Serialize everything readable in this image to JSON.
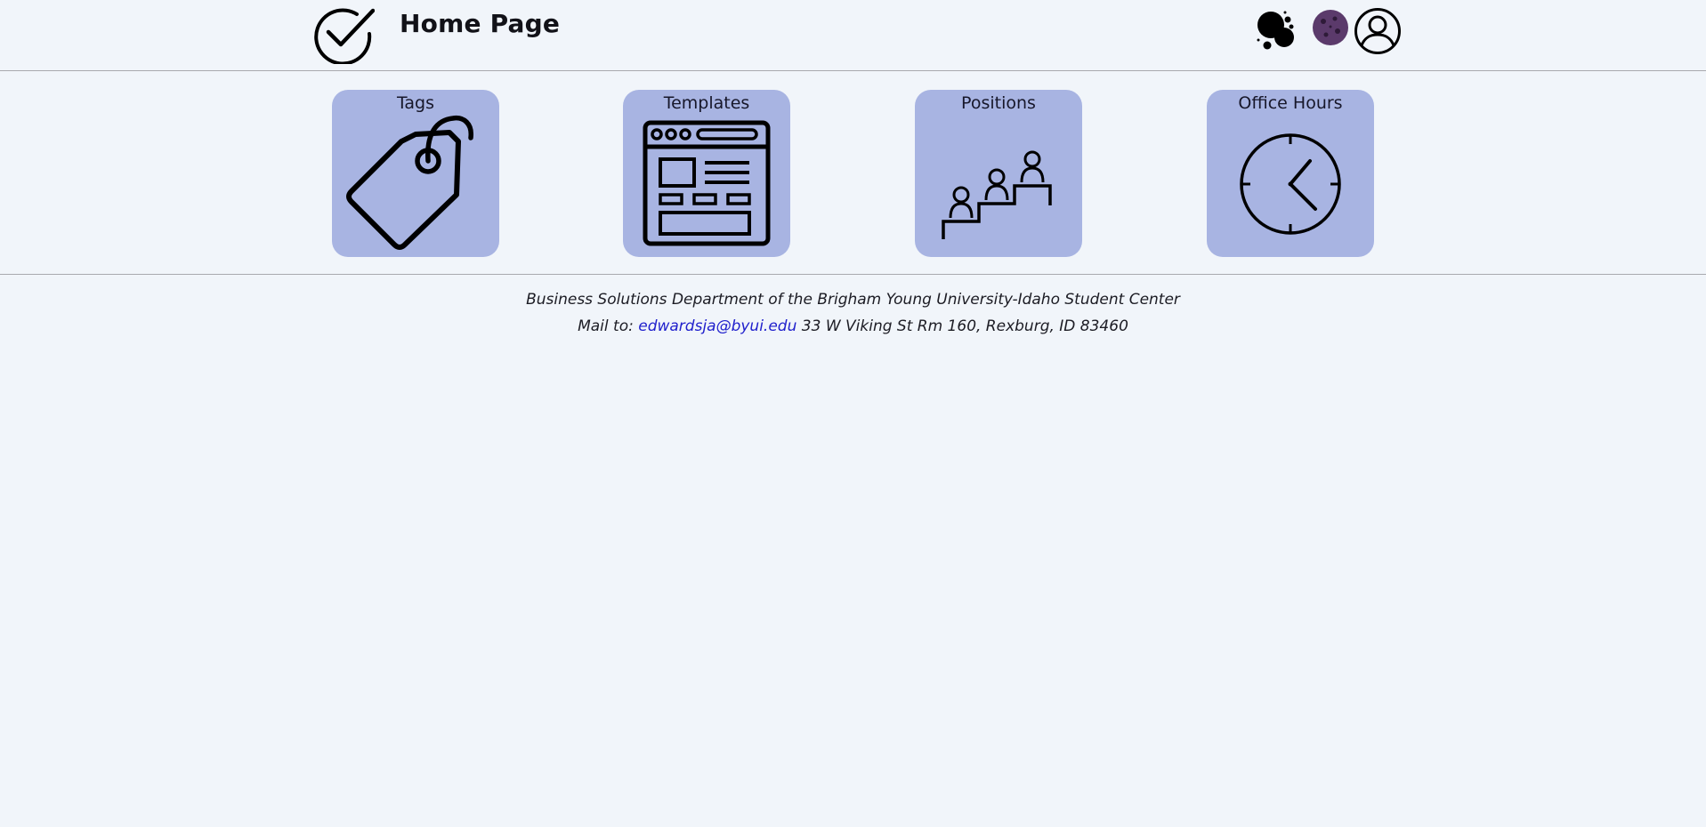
{
  "header": {
    "title": "Home Page",
    "logo_icon": "check-circle-icon",
    "theme_icon": "theme-bubbles-icon",
    "cookie_icon": "cookie-icon",
    "account_icon": "user-circle-icon"
  },
  "cards": [
    {
      "label": "Tags",
      "icon": "tag-icon"
    },
    {
      "label": "Templates",
      "icon": "template-layout-icon"
    },
    {
      "label": "Positions",
      "icon": "positions-stairs-icon"
    },
    {
      "label": "Office Hours",
      "icon": "clock-icon"
    }
  ],
  "footer": {
    "line1": "Business Solutions Department of the Brigham Young University-Idaho Student Center",
    "mail_prefix": "Mail to:",
    "email": "edwardsja@byui.edu",
    "address": "33 W Viking St Rm 160, Rexburg, ID 83460"
  },
  "colors": {
    "background": "#f1f5fa",
    "card": "#a8b4e2",
    "link": "#1f1fcc",
    "cookie": "#5b3a6b"
  }
}
